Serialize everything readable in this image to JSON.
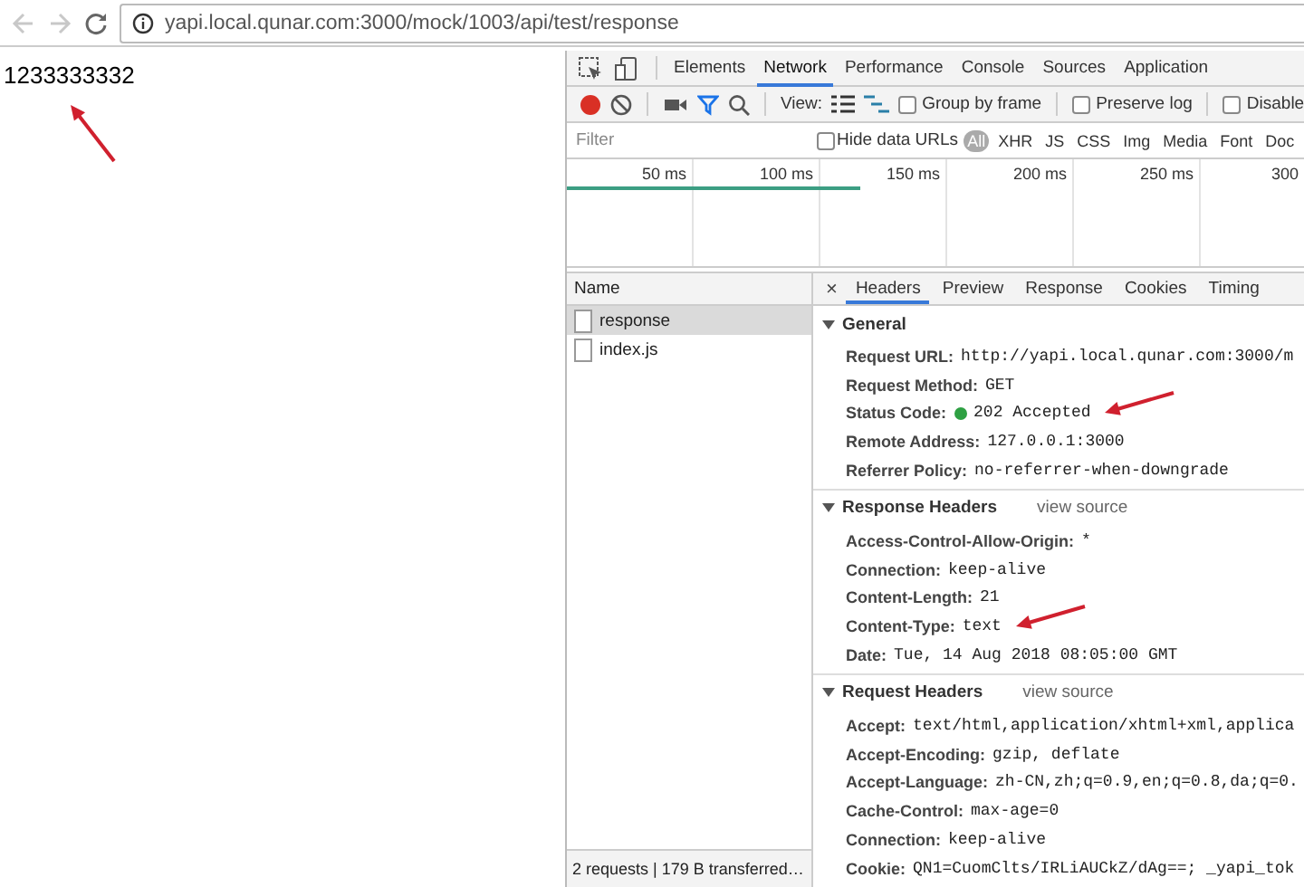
{
  "browser": {
    "back_disabled": true,
    "forward_disabled": true,
    "url": "yapi.local.qunar.com:3000/mock/1003/api/test/response"
  },
  "page": {
    "body_text": "1233333332"
  },
  "devtools": {
    "panel_tabs": [
      {
        "label": "Elements",
        "selected": false
      },
      {
        "label": "Network",
        "selected": true
      },
      {
        "label": "Performance",
        "selected": false
      },
      {
        "label": "Console",
        "selected": false
      },
      {
        "label": "Sources",
        "selected": false
      },
      {
        "label": "Application",
        "selected": false
      }
    ],
    "toolbar": {
      "recording": true,
      "filter_active": true,
      "view_label": "View:",
      "checkboxes": [
        {
          "label": "Group by frame",
          "checked": false
        },
        {
          "label": "Preserve log",
          "checked": false
        },
        {
          "label": "Disable",
          "checked": false
        }
      ]
    },
    "filter_bar": {
      "placeholder": "Filter",
      "hide_data_urls": {
        "label": "Hide data URLs",
        "checked": false
      },
      "types": [
        {
          "label": "All",
          "selected": true
        },
        {
          "label": "XHR",
          "selected": false
        },
        {
          "label": "JS",
          "selected": false
        },
        {
          "label": "CSS",
          "selected": false
        },
        {
          "label": "Img",
          "selected": false
        },
        {
          "label": "Media",
          "selected": false
        },
        {
          "label": "Font",
          "selected": false
        },
        {
          "label": "Doc",
          "selected": false
        }
      ]
    },
    "timeline": {
      "ticks": [
        "50 ms",
        "100 ms",
        "150 ms",
        "200 ms",
        "250 ms",
        "300"
      ]
    },
    "requests": {
      "column": "Name",
      "rows": [
        {
          "name": "response",
          "selected": true
        },
        {
          "name": "index.js",
          "selected": false
        }
      ]
    },
    "detail_tabs": {
      "close": "×",
      "tabs": [
        {
          "label": "Headers",
          "selected": true
        },
        {
          "label": "Preview",
          "selected": false
        },
        {
          "label": "Response",
          "selected": false
        },
        {
          "label": "Cookies",
          "selected": false
        },
        {
          "label": "Timing",
          "selected": false
        }
      ]
    },
    "sections": [
      {
        "title": "General",
        "expanded": true,
        "rows": [
          {
            "name": "Request URL:",
            "value": "http://yapi.local.qunar.com:3000/m"
          },
          {
            "name": "Request Method:",
            "value": "GET"
          },
          {
            "name": "Status Code:",
            "value": "202 Accepted",
            "color": "#2ea043"
          },
          {
            "name": "Remote Address:",
            "value": "127.0.0.1:3000"
          },
          {
            "name": "Referrer Policy:",
            "value": "no-referrer-when-downgrade"
          }
        ]
      },
      {
        "title": "Response Headers",
        "expanded": true,
        "link": "view source",
        "rows": [
          {
            "name": "Access-Control-Allow-Origin:",
            "value": "*"
          },
          {
            "name": "Connection:",
            "value": "keep-alive"
          },
          {
            "name": "Content-Length:",
            "value": "21"
          },
          {
            "name": "Content-Type:",
            "value": "text"
          },
          {
            "name": "Date:",
            "value": "Tue, 14 Aug 2018 08:05:00 GMT"
          }
        ]
      },
      {
        "title": "Request Headers",
        "expanded": true,
        "link": "view source",
        "rows": [
          {
            "name": "Accept:",
            "value": "text/html,application/xhtml+xml,applica"
          },
          {
            "name": "Accept-Encoding:",
            "value": "gzip, deflate"
          },
          {
            "name": "Accept-Language:",
            "value": "zh-CN,zh;q=0.9,en;q=0.8,da;q=0."
          },
          {
            "name": "Cache-Control:",
            "value": "max-age=0"
          },
          {
            "name": "Connection:",
            "value": "keep-alive"
          },
          {
            "name": "Cookie:",
            "value": "QN1=CuomClts/IRLiAUCkZ/dAg==; _yapi_tok"
          }
        ]
      }
    ],
    "status_bar": "2 requests | 179 B transferred…"
  }
}
